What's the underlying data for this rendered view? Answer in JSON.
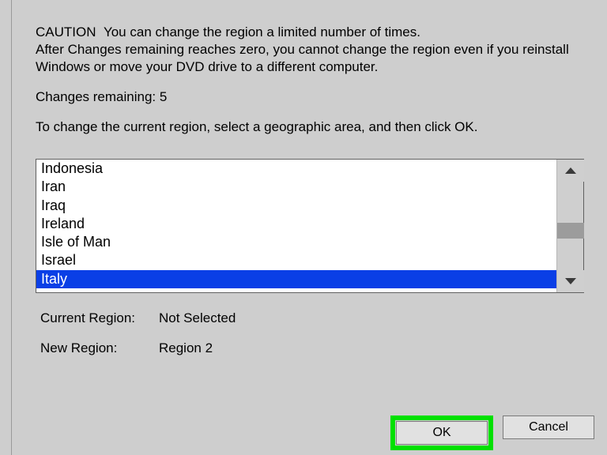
{
  "caution": {
    "label": "CAUTION",
    "text": "You can change the region a limited number of times.\nAfter Changes remaining reaches zero, you cannot change the region even if you reinstall Windows or move your DVD drive to a different computer."
  },
  "changes_remaining_label": "Changes remaining:",
  "changes_remaining_value": "5",
  "instruction": "To change the current region, select a geographic area, and then click OK.",
  "listbox": {
    "items": [
      "Indonesia",
      "Iran",
      "Iraq",
      "Ireland",
      "Isle of Man",
      "Israel",
      "Italy"
    ],
    "selected_index": 6
  },
  "info": {
    "current_region_label": "Current Region:",
    "current_region_value": "Not Selected",
    "new_region_label": "New Region:",
    "new_region_value": "Region 2"
  },
  "buttons": {
    "ok": "OK",
    "cancel": "Cancel"
  }
}
